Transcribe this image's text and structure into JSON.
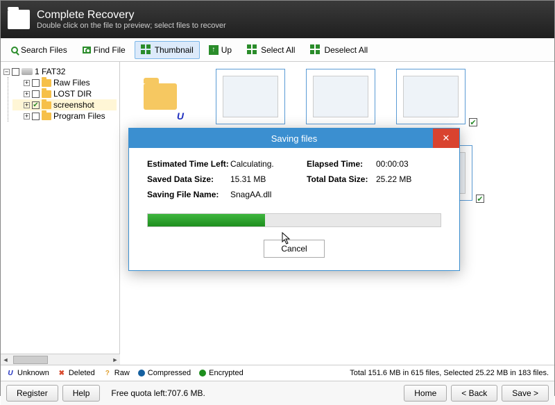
{
  "header": {
    "title": "Complete Recovery",
    "subtitle": "Double click on the file to preview; select files to recover"
  },
  "toolbar": {
    "search": "Search Files",
    "find": "Find File",
    "thumbnail": "Thumbnail",
    "up": "Up",
    "selectAll": "Select All",
    "deselectAll": "Deselect All"
  },
  "tree": {
    "root": "1 FAT32",
    "items": [
      {
        "label": "Raw Files",
        "checked": false
      },
      {
        "label": "LOST DIR",
        "checked": false
      },
      {
        "label": "screenshot",
        "checked": true
      },
      {
        "label": "Program Files",
        "checked": false
      }
    ]
  },
  "dialog": {
    "title": "Saving files",
    "estLabel": "Estimated Time Left:",
    "estValue": "Calculating.",
    "elapsedLabel": "Elapsed Time:",
    "elapsedValue": "00:00:03",
    "savedLabel": "Saved Data Size:",
    "savedValue": "15.31 MB",
    "totalLabel": "Total Data Size:",
    "totalValue": "25.22 MB",
    "fileLabel": "Saving File Name:",
    "fileValue": "SnagAA.dll",
    "cancel": "Cancel"
  },
  "legend": {
    "unknown": "Unknown",
    "deleted": "Deleted",
    "raw": "Raw",
    "compressed": "Compressed",
    "encrypted": "Encrypted",
    "status": "Total 151.6 MB in 615 files, Selected 25.22 MB in 183 files."
  },
  "footer": {
    "register": "Register",
    "help": "Help",
    "quota": "Free quota left:707.6 MB.",
    "home": "Home",
    "back": "< Back",
    "save": "Save >"
  }
}
